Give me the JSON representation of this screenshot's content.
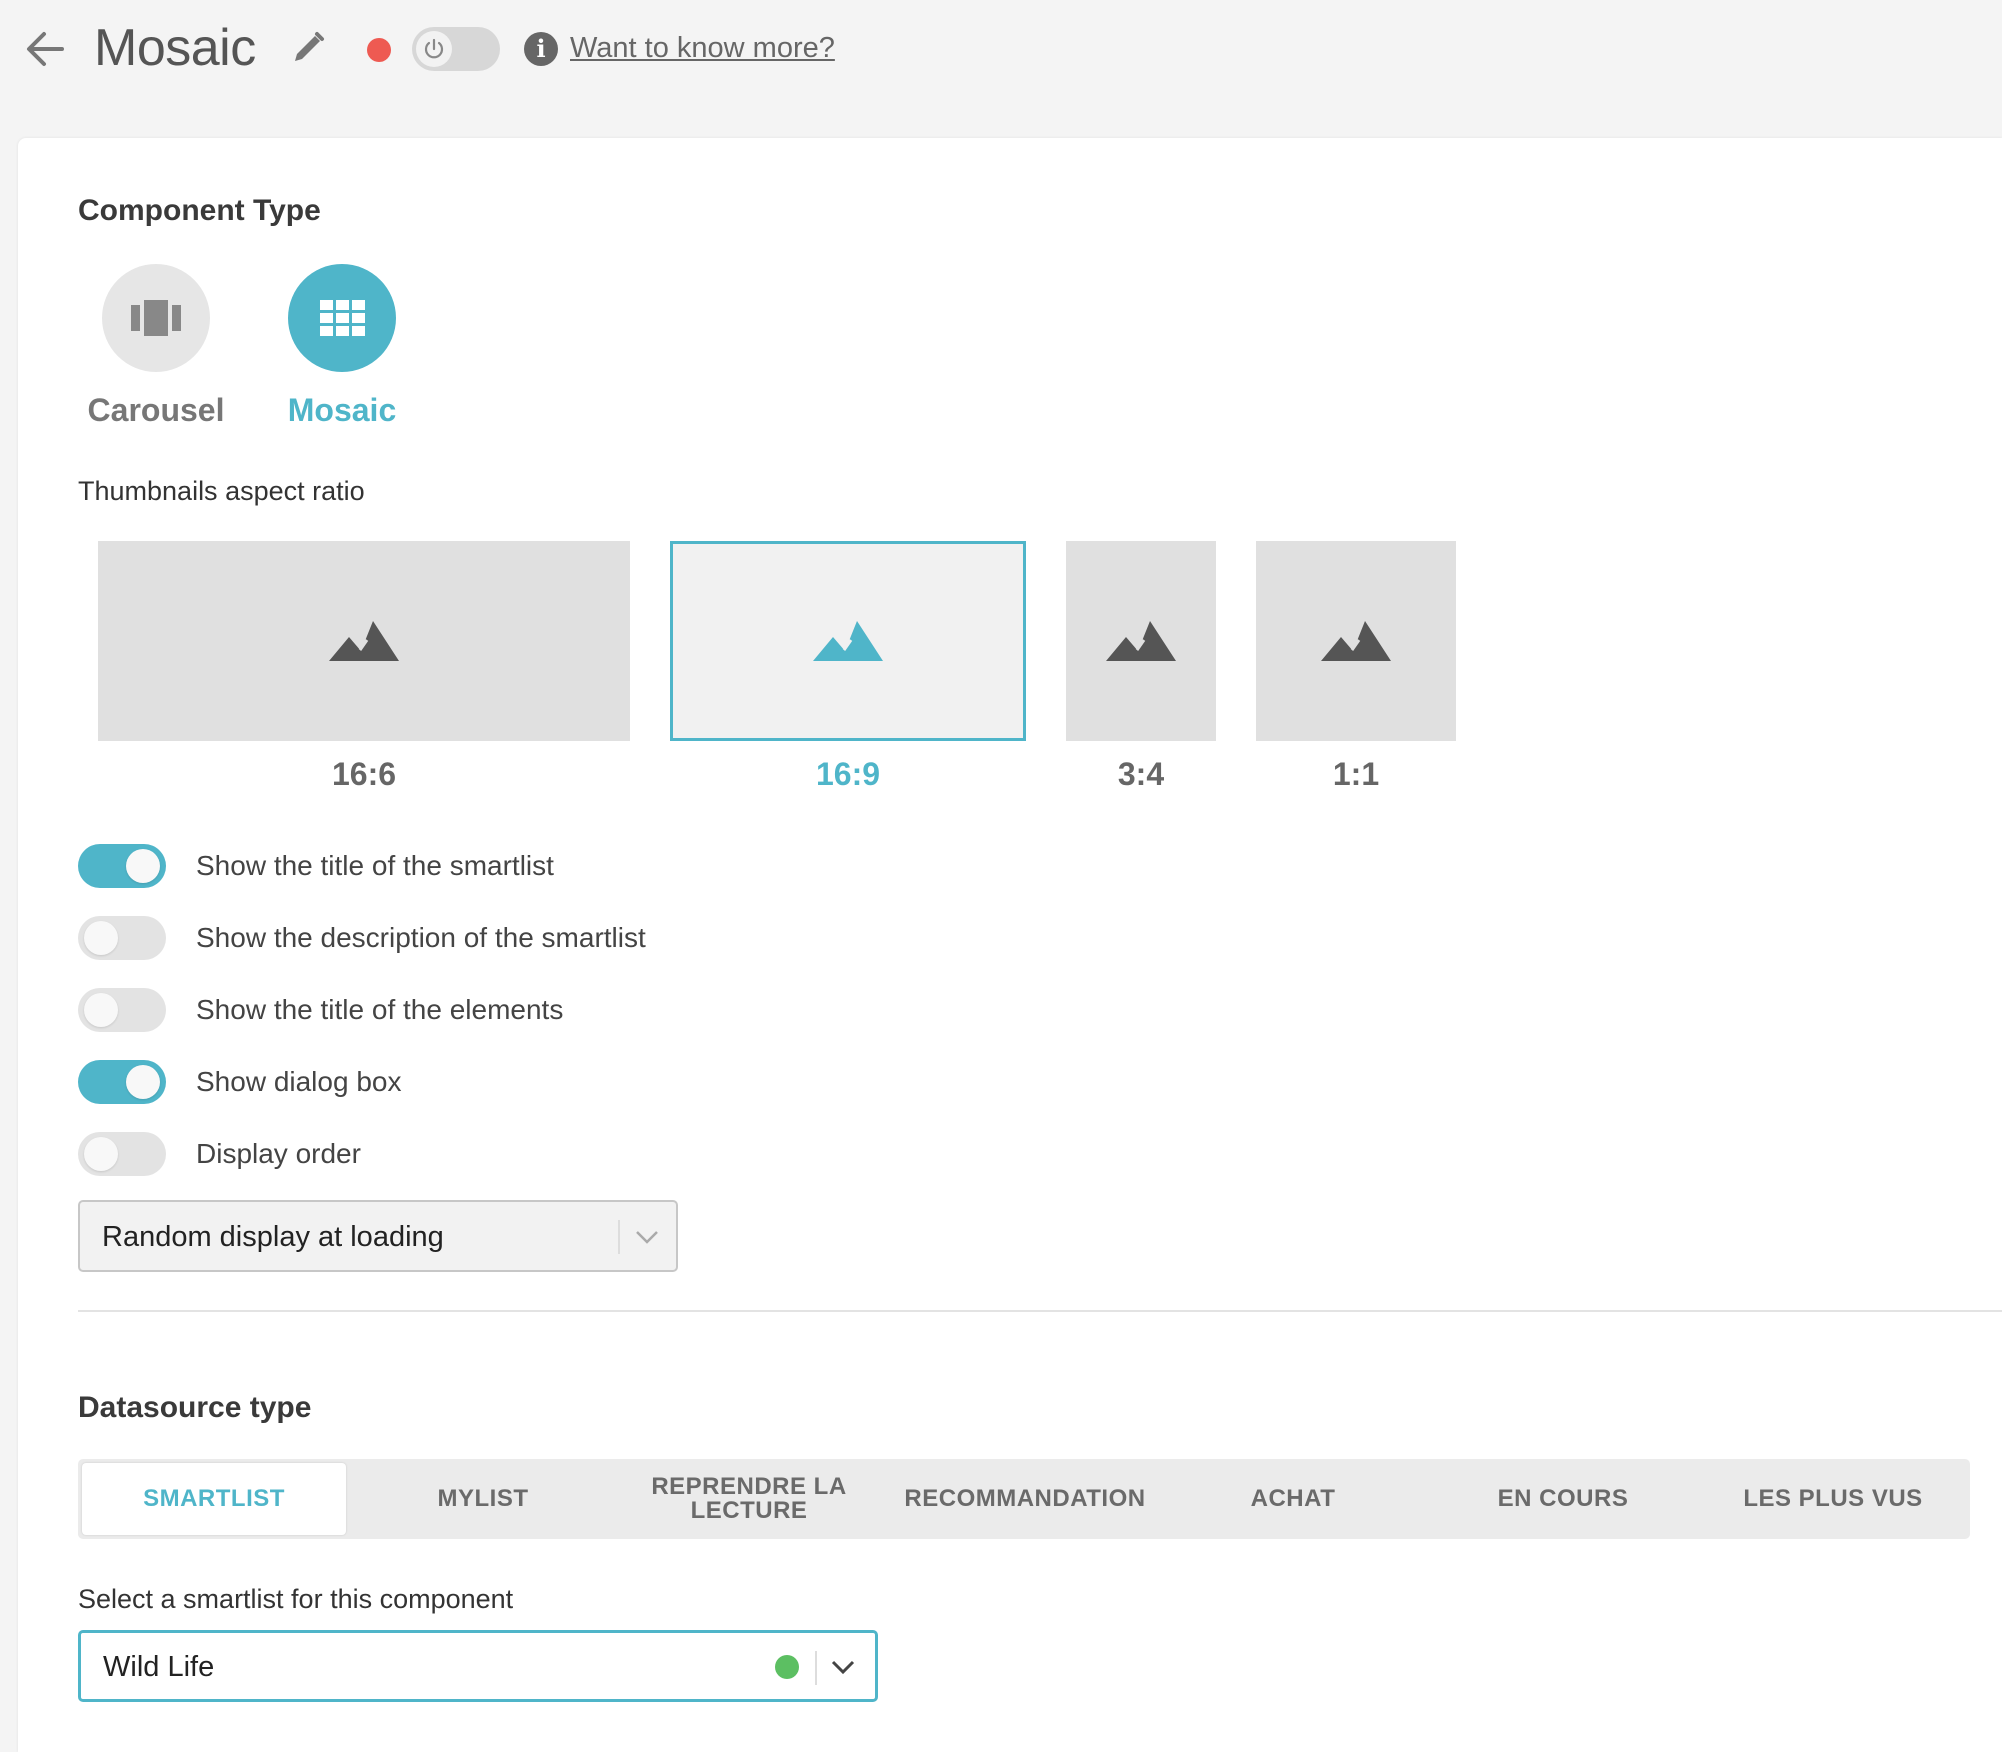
{
  "header": {
    "title": "Mosaic",
    "status_color": "#ee5a52",
    "info_glyph": "i",
    "know_more_link": "Want to know more?"
  },
  "component_type": {
    "title": "Component Type",
    "options": [
      {
        "label": "Carousel",
        "icon": "carousel-icon",
        "selected": false
      },
      {
        "label": "Mosaic",
        "icon": "grid-icon",
        "selected": true
      }
    ]
  },
  "aspect_ratio": {
    "title": "Thumbnails aspect ratio",
    "options": [
      {
        "label": "16:6",
        "selected": false
      },
      {
        "label": "16:9",
        "selected": true
      },
      {
        "label": "3:4",
        "selected": false
      },
      {
        "label": "1:1",
        "selected": false
      }
    ]
  },
  "toggles": [
    {
      "label": "Show the title of the smartlist",
      "on": true
    },
    {
      "label": "Show the description of the smartlist",
      "on": false
    },
    {
      "label": "Show the title of the elements",
      "on": false
    },
    {
      "label": "Show dialog box",
      "on": true
    },
    {
      "label": "Display order",
      "on": false
    }
  ],
  "display_order_select": {
    "value": "Random display at loading"
  },
  "datasource": {
    "title": "Datasource type",
    "tabs": [
      {
        "label": "SMARTLIST",
        "active": true
      },
      {
        "label": "MYLIST",
        "active": false
      },
      {
        "label": "REPRENDRE LA LECTURE",
        "active": false
      },
      {
        "label": "RECOMMANDATION",
        "active": false
      },
      {
        "label": "ACHAT",
        "active": false
      },
      {
        "label": "EN COURS",
        "active": false
      },
      {
        "label": "LES PLUS VUS",
        "active": false
      }
    ]
  },
  "smartlist_select": {
    "label": "Select a smartlist for this component",
    "value": "Wild Life",
    "status_color": "#5cbf62"
  },
  "colors": {
    "accent": "#4fb5c9",
    "inactive": "#777777"
  }
}
